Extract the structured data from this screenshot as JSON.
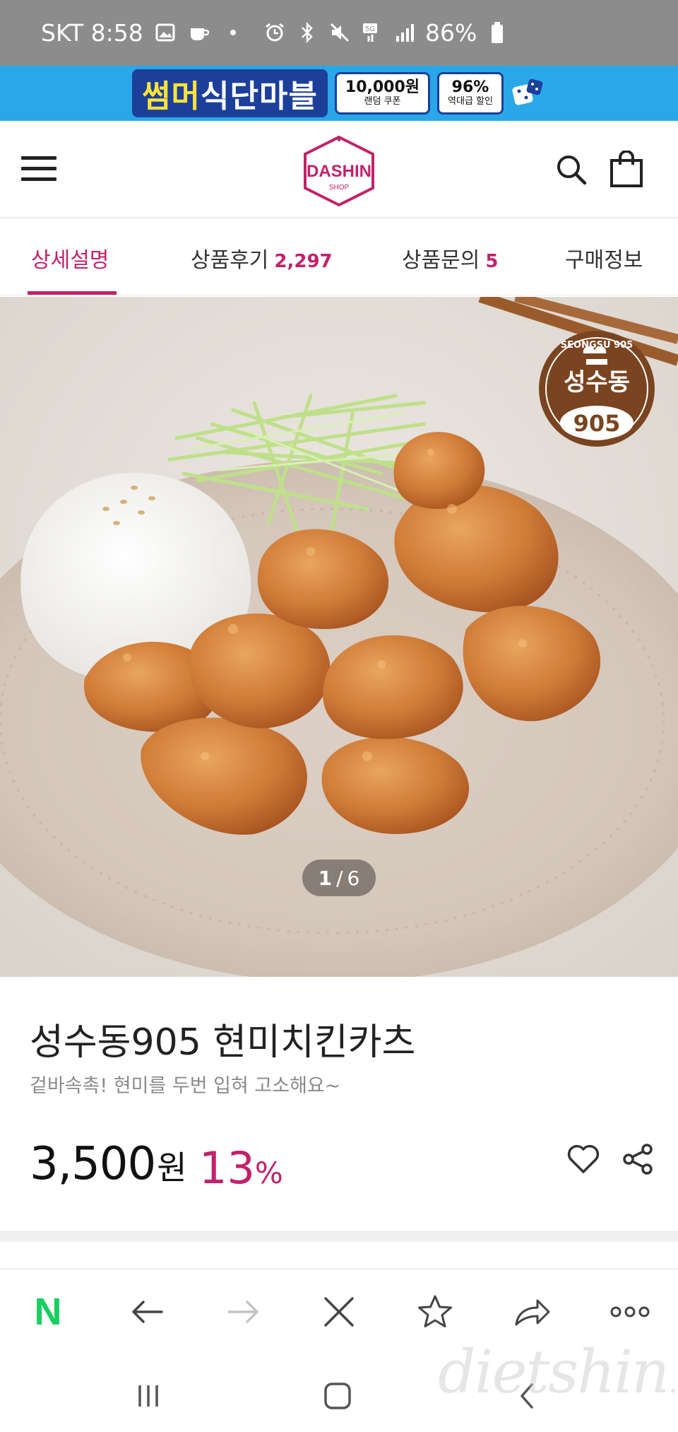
{
  "status_bar": {
    "carrier_time": "SKT 8:58",
    "battery": "86%"
  },
  "banner": {
    "title_part1": "썸머",
    "title_part2": "식단마블",
    "coupon1_big": "10,000원",
    "coupon1_small": "랜덤 쿠폰",
    "coupon2_big": "96%",
    "coupon2_small": "역대급 할인"
  },
  "header": {
    "logo_text": "DASHIN",
    "logo_sub": "SHOP"
  },
  "tabs": [
    {
      "label": "상세설명",
      "count": ""
    },
    {
      "label": "상품후기",
      "count": "2,297"
    },
    {
      "label": "상품문의",
      "count": "5"
    },
    {
      "label": "구매정보",
      "count": ""
    }
  ],
  "hero": {
    "badge_top": "SEONGSU 905",
    "badge_mid": "성수동",
    "badge_num": "905",
    "pager_current": "1",
    "pager_sep": "/",
    "pager_total": "6"
  },
  "product": {
    "name": "성수동905 현미치킨카츠",
    "description": "겉바속촉! 현미를 두번 입혀 고소해요~",
    "price": "3,500",
    "price_unit": "원",
    "discount": "13",
    "discount_unit": "%"
  },
  "browser": {
    "home_logo": "N"
  },
  "watermark": {
    "main": "dietshin",
    "suffix": ".com"
  },
  "colors": {
    "accent": "#c2226a",
    "banner_bg": "#2aa7e8",
    "status_bg": "#8c8c8c"
  }
}
